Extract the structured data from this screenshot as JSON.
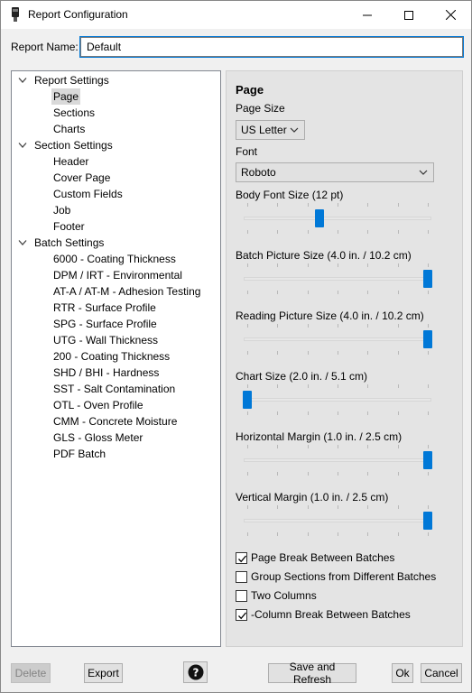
{
  "window": {
    "title": "Report Configuration"
  },
  "report_name": {
    "label": "Report Name:",
    "value": "Default"
  },
  "tree": {
    "groups": [
      {
        "label": "Report Settings",
        "children": [
          "Page",
          "Sections",
          "Charts"
        ]
      },
      {
        "label": "Section Settings",
        "children": [
          "Header",
          "Cover Page",
          "Custom Fields",
          "Job",
          "Footer"
        ]
      },
      {
        "label": "Batch Settings",
        "children": [
          "6000 - Coating Thickness",
          "DPM / IRT - Environmental",
          "AT-A / AT-M - Adhesion Testing",
          "RTR - Surface Profile",
          "SPG - Surface Profile",
          "UTG - Wall Thickness",
          "200 - Coating Thickness",
          "SHD / BHI - Hardness",
          "SST - Salt Contamination",
          "OTL - Oven Profile",
          "CMM - Concrete Moisture",
          "GLS - Gloss Meter",
          "PDF Batch"
        ]
      }
    ],
    "selected": "Page"
  },
  "page_panel": {
    "title": "Page",
    "page_size": {
      "label": "Page Size",
      "value": "US Letter"
    },
    "font": {
      "label": "Font",
      "value": "Roboto"
    },
    "sliders": [
      {
        "label": "Body Font Size (12 pt)",
        "level": 0.4
      },
      {
        "label": "Batch Picture Size (4.0 in. / 10.2 cm)",
        "level": 1.0
      },
      {
        "label": "Reading Picture Size (4.0 in. / 10.2 cm)",
        "level": 1.0
      },
      {
        "label": "Chart Size (2.0 in. / 5.1 cm)",
        "level": 0.0
      },
      {
        "label": "Horizontal Margin (1.0 in. / 2.5 cm)",
        "level": 1.0
      },
      {
        "label": "Vertical Margin (1.0 in. / 2.5 cm)",
        "level": 1.0
      }
    ],
    "checkboxes": [
      {
        "label": "Page Break Between Batches",
        "checked": true
      },
      {
        "label": "Group Sections from Different Batches",
        "checked": false
      },
      {
        "label": "Two Columns",
        "checked": false
      },
      {
        "label": "-Column Break Between Batches",
        "checked": true
      }
    ]
  },
  "buttons": {
    "delete": "Delete",
    "export": "Export",
    "help": "?",
    "save_refresh": "Save and Refresh",
    "ok": "Ok",
    "cancel": "Cancel"
  },
  "colors": {
    "accent": "#0078d7",
    "selection": "#d9d9d9"
  },
  "icons": [
    "app-icon",
    "minimize-icon",
    "maximize-icon",
    "close-icon",
    "chevron-down-icon",
    "help-icon",
    "check-icon"
  ]
}
